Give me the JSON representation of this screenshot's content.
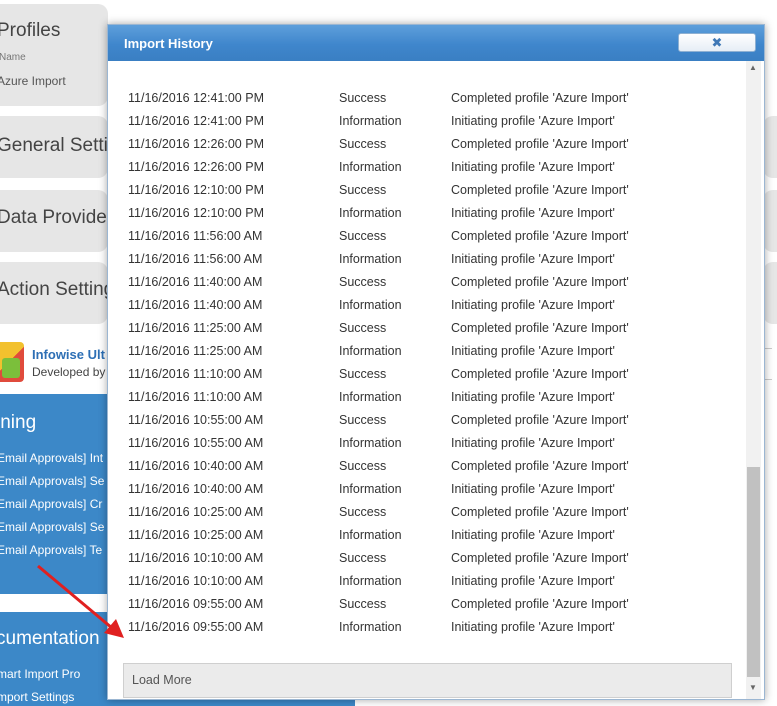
{
  "background": {
    "profiles_title": "Profiles",
    "name_label": "Name",
    "profile_name": "Azure Import",
    "sections": [
      "General Settin",
      "Data Provider",
      "Action Setting"
    ],
    "app_name": "Infowise Ult",
    "app_dev": "Developed by",
    "training_title": "ining",
    "training_links": [
      "Email Approvals] Int",
      "Email Approvals] Se",
      "Email Approvals] Cr",
      "Email Approvals] Se",
      "Email Approvals] Te"
    ],
    "documentation_title": "cumentation",
    "doc_links": [
      "mart Import Pro",
      "mport Settings"
    ]
  },
  "dialog": {
    "title": "Import History",
    "close_glyph": "✖",
    "load_more": "Load More"
  },
  "rows": [
    {
      "date": "11/16/2016 12:41:00 PM",
      "type": "Success",
      "msg": "Completed profile 'Azure Import'"
    },
    {
      "date": "11/16/2016 12:41:00 PM",
      "type": "Information",
      "msg": "Initiating profile 'Azure Import'"
    },
    {
      "date": "11/16/2016 12:26:00 PM",
      "type": "Success",
      "msg": "Completed profile 'Azure Import'"
    },
    {
      "date": "11/16/2016 12:26:00 PM",
      "type": "Information",
      "msg": "Initiating profile 'Azure Import'"
    },
    {
      "date": "11/16/2016 12:10:00 PM",
      "type": "Success",
      "msg": "Completed profile 'Azure Import'"
    },
    {
      "date": "11/16/2016 12:10:00 PM",
      "type": "Information",
      "msg": "Initiating profile 'Azure Import'"
    },
    {
      "date": "11/16/2016 11:56:00 AM",
      "type": "Success",
      "msg": "Completed profile 'Azure Import'"
    },
    {
      "date": "11/16/2016 11:56:00 AM",
      "type": "Information",
      "msg": "Initiating profile 'Azure Import'"
    },
    {
      "date": "11/16/2016 11:40:00 AM",
      "type": "Success",
      "msg": "Completed profile 'Azure Import'"
    },
    {
      "date": "11/16/2016 11:40:00 AM",
      "type": "Information",
      "msg": "Initiating profile 'Azure Import'"
    },
    {
      "date": "11/16/2016 11:25:00 AM",
      "type": "Success",
      "msg": "Completed profile 'Azure Import'"
    },
    {
      "date": "11/16/2016 11:25:00 AM",
      "type": "Information",
      "msg": "Initiating profile 'Azure Import'"
    },
    {
      "date": "11/16/2016 11:10:00 AM",
      "type": "Success",
      "msg": "Completed profile 'Azure Import'"
    },
    {
      "date": "11/16/2016 11:10:00 AM",
      "type": "Information",
      "msg": "Initiating profile 'Azure Import'"
    },
    {
      "date": "11/16/2016 10:55:00 AM",
      "type": "Success",
      "msg": "Completed profile 'Azure Import'"
    },
    {
      "date": "11/16/2016 10:55:00 AM",
      "type": "Information",
      "msg": "Initiating profile 'Azure Import'"
    },
    {
      "date": "11/16/2016 10:40:00 AM",
      "type": "Success",
      "msg": "Completed profile 'Azure Import'"
    },
    {
      "date": "11/16/2016 10:40:00 AM",
      "type": "Information",
      "msg": "Initiating profile 'Azure Import'"
    },
    {
      "date": "11/16/2016 10:25:00 AM",
      "type": "Success",
      "msg": "Completed profile 'Azure Import'"
    },
    {
      "date": "11/16/2016 10:25:00 AM",
      "type": "Information",
      "msg": "Initiating profile 'Azure Import'"
    },
    {
      "date": "11/16/2016 10:10:00 AM",
      "type": "Success",
      "msg": "Completed profile 'Azure Import'"
    },
    {
      "date": "11/16/2016 10:10:00 AM",
      "type": "Information",
      "msg": "Initiating profile 'Azure Import'"
    },
    {
      "date": "11/16/2016 09:55:00 AM",
      "type": "Success",
      "msg": "Completed profile 'Azure Import'"
    },
    {
      "date": "11/16/2016 09:55:00 AM",
      "type": "Information",
      "msg": "Initiating profile 'Azure Import'"
    }
  ],
  "colors": {
    "titlebar": "#3f86cc",
    "sidebar_blue": "#3c88c8",
    "arrow": "#e02020"
  }
}
